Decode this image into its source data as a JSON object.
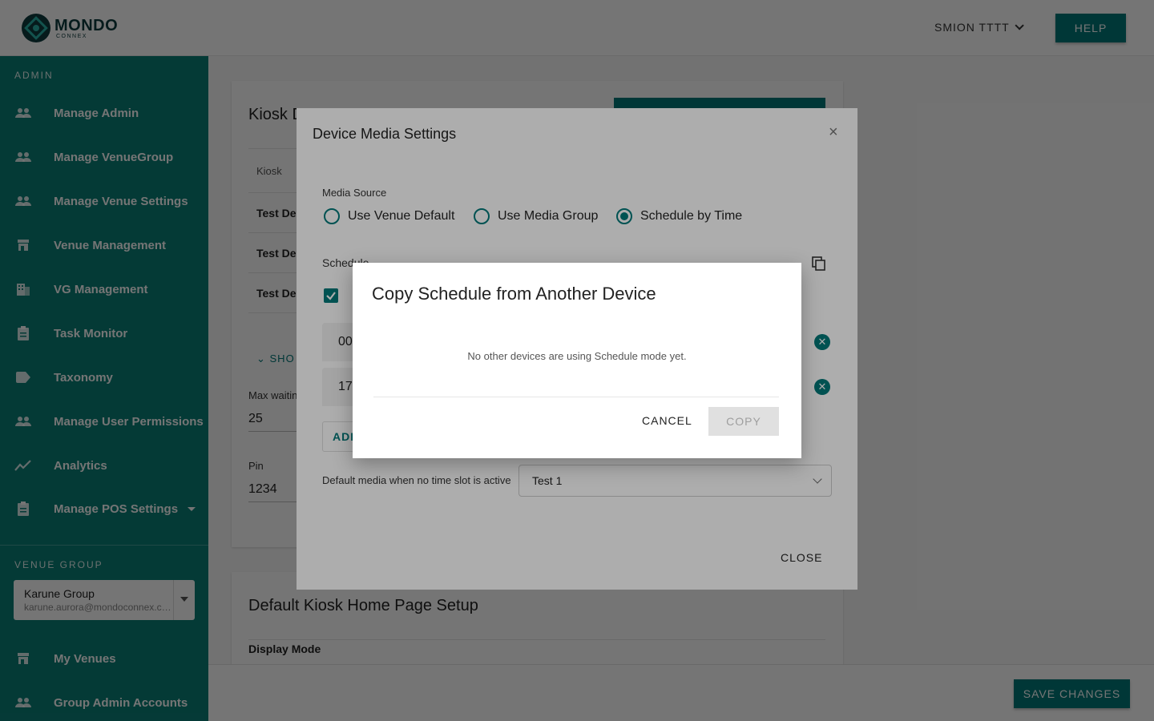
{
  "header": {
    "logo_name": "MONDO",
    "logo_sub": "CONNEX",
    "user_label": "SMION TTTT",
    "help_label": "HELP"
  },
  "sidebar": {
    "admin_section": "ADMIN",
    "items": [
      {
        "label": "Manage Admin",
        "icon": "people-icon"
      },
      {
        "label": "Manage VenueGroup",
        "icon": "people-icon"
      },
      {
        "label": "Manage Venue Settings",
        "icon": "people-icon"
      },
      {
        "label": "Venue Management",
        "icon": "store-icon"
      },
      {
        "label": "VG Management",
        "icon": "building-icon"
      },
      {
        "label": "Task Monitor",
        "icon": "clipboard-icon"
      },
      {
        "label": "Taxonomy",
        "icon": "tag-icon"
      },
      {
        "label": "Manage User Permissions",
        "icon": "people-icon"
      },
      {
        "label": "Analytics",
        "icon": "chart-line-icon"
      },
      {
        "label": "Manage POS Settings",
        "icon": "clipboard-icon"
      }
    ],
    "venue_group_section": "VENUE GROUP",
    "venue_group": {
      "name": "Karune Group",
      "email": "karune.aurora@mondoconnex.com"
    },
    "bottom_items": [
      {
        "label": "My Venues",
        "icon": "store-icon"
      },
      {
        "label": "Group Admin Accounts",
        "icon": "people-icon"
      }
    ]
  },
  "page": {
    "kiosk_title": "Kiosk D",
    "table_header": "Kiosk",
    "rows": [
      "Test De",
      "Test De",
      "Test De"
    ],
    "show_more": "SHO",
    "max_waiting_label": "Max waitin",
    "max_waiting_value": "25",
    "pin_label": "Pin",
    "pin_value": "1234",
    "home_setup_title": "Default Kiosk Home Page Setup",
    "display_mode_label": "Display Mode",
    "save_label": "SAVE CHANGES"
  },
  "device_media_dialog": {
    "title": "Device Media Settings",
    "media_source_label": "Media Source",
    "options": [
      {
        "label": "Use Venue Default",
        "selected": false
      },
      {
        "label": "Use Media Group",
        "selected": false
      },
      {
        "label": "Schedule by Time",
        "selected": true
      }
    ],
    "schedule_label": "Schedule",
    "slots": [
      "00",
      "17"
    ],
    "add_label": "ADD",
    "default_media_label": "Default media when no time slot is active",
    "default_media_value": "Test 1",
    "close_label": "CLOSE"
  },
  "copy_dialog": {
    "title": "Copy Schedule from Another Device",
    "message": "No other devices are using Schedule mode yet.",
    "cancel_label": "CANCEL",
    "copy_label": "COPY"
  },
  "colors": {
    "brand": "#00797a",
    "sidebar": "#0b7f77"
  }
}
